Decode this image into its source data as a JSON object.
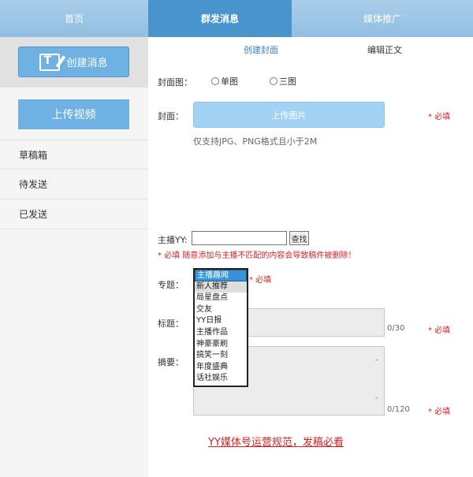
{
  "topnav": {
    "tabs": [
      "首页",
      "群发消息",
      "媒体推广"
    ]
  },
  "sidebar": {
    "create_label": "创建消息",
    "upload_video_label": "上传视频",
    "items": [
      "草稿箱",
      "待发送",
      "已发送"
    ]
  },
  "main": {
    "subtabs": [
      "创建封面",
      "编辑正文"
    ],
    "cover_type_label": "封面图：",
    "radio_single": "单图",
    "radio_triple": "三图",
    "cover_label": "封面：",
    "upload_image_label": "上传图片",
    "required": "* 必填",
    "format_hint": "仅支持JPG、PNG格式且小于2M",
    "host_label": "主播YY:",
    "host_value": "",
    "search_label": "查找",
    "host_warning": "* 必填 随意添加与主播不匹配的内容会导致稿件被删除！",
    "topic_label": "专题：",
    "topic_options": [
      "主播趣闻",
      "新人推荐",
      "局星盘点",
      "交友",
      "YY日报",
      "主播作品",
      "神豪豪刷",
      "搞笑一刻",
      "年度盛典",
      "话社娱乐"
    ],
    "title_label": "标题：",
    "title_count": "0/30",
    "summary_label": "摘要：",
    "summary_count": "0/120",
    "rules_link": "YY媒体号运营规范，发稿必看"
  }
}
